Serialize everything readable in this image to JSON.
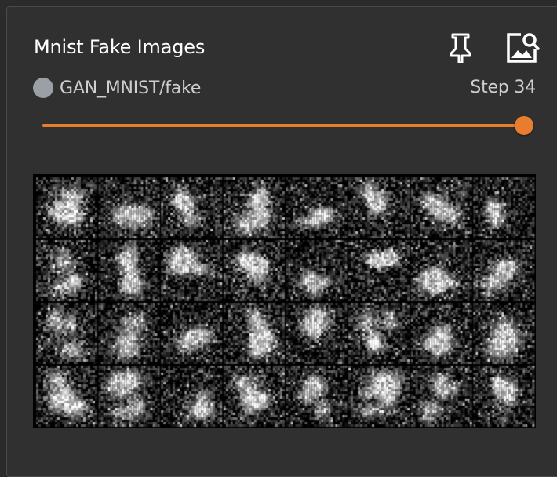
{
  "card": {
    "title": "Mnist Fake Images"
  },
  "toolbar": {
    "pin_icon": "pin-icon",
    "image_search_icon": "image-search-icon"
  },
  "run": {
    "name": "GAN_MNIST/fake",
    "color": "#9aa0a6"
  },
  "step": {
    "label": "Step 34",
    "value": 34,
    "slider_fraction": 1.0
  },
  "image_grid": {
    "rows": 4,
    "cols": 8,
    "description_kind": "noisy generated digit samples",
    "accent_color": "#e87d2f"
  }
}
